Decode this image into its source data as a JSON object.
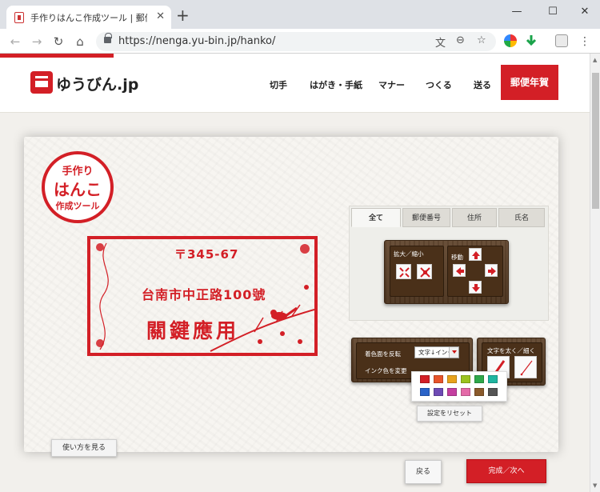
{
  "browser": {
    "tab_title": "手作りはんこ作成ツール | 郵便年",
    "url": "https://nenga.yu-bin.jp/hanko/",
    "window_controls": [
      "minimize-icon",
      "maximize-icon",
      "close-icon"
    ]
  },
  "site": {
    "logo_text": "ゆうびん.jp",
    "nav": [
      "切手",
      "はがき・手紙",
      "マナー",
      "つくる",
      "送る"
    ],
    "nav_cta": "郵便年賀"
  },
  "badge": {
    "line1": "手作り",
    "line2": "はんこ",
    "line3": "作成ツール"
  },
  "stamp": {
    "postal_code": "〒345-67",
    "address": "台南市中正路100號",
    "name": "關鍵應用"
  },
  "tabs": [
    "全て",
    "郵便番号",
    "住所",
    "氏名"
  ],
  "tabs_active": "全て",
  "controls": {
    "zoom_label": "拡大／縮小",
    "move_label": "移動",
    "invert_label": "着色面を反転",
    "ink_label": "インク色を変更",
    "ink_select_value": "文字↓インク",
    "stroke_label": "文字を太く／細く",
    "reset_button": "設定をリセット"
  },
  "palette_colors": [
    "#d31f26",
    "#e8542a",
    "#e8a21b",
    "#9bc31f",
    "#2fa84a",
    "#1fb5a0",
    "#2a63c8",
    "#6e4bb5",
    "#c43fa0",
    "#e46aa8",
    "#8a5a2b",
    "#555555"
  ],
  "buttons": {
    "how_to": "使い方を見る",
    "back": "戻る",
    "next": "完成／次へ"
  },
  "accent_color": "#d31f26"
}
